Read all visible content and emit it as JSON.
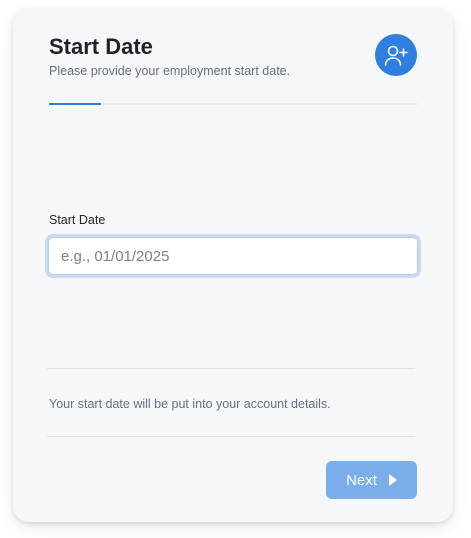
{
  "header": {
    "title": "Start Date",
    "subtitle": "Please provide your employment start date.",
    "avatar_icon": "add-user-icon"
  },
  "progress": {
    "fraction": 0.14
  },
  "form": {
    "start_date_label": "Start Date",
    "start_date_placeholder": "e.g., 01/01/2025",
    "start_date_value": ""
  },
  "footer": {
    "help_text": "Your start date will be put into your account details.",
    "next_label": "Next",
    "next_icon": "caret-right-icon"
  },
  "colors": {
    "accent": "#2f7fe0",
    "button_disabled": "#7aaeea"
  }
}
